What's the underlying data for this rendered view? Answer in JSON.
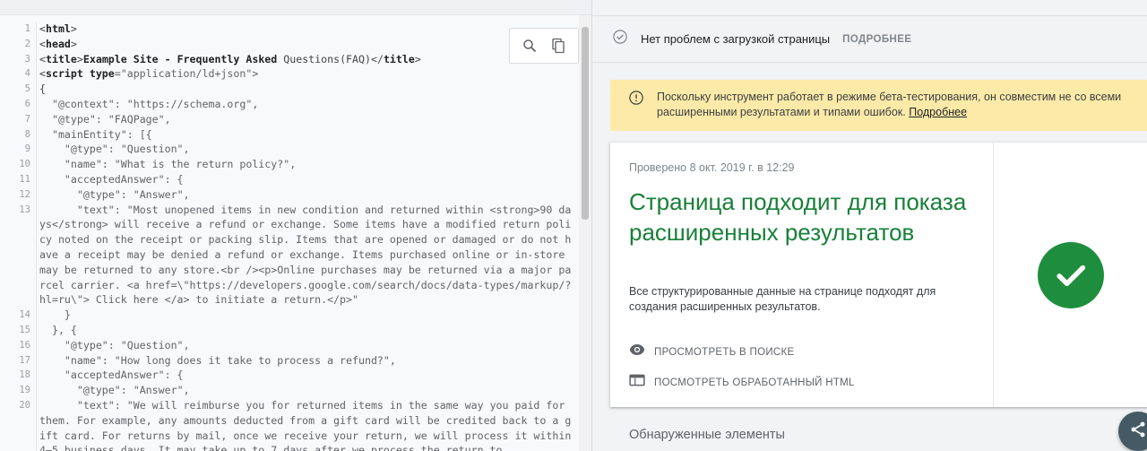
{
  "code": {
    "lines": [
      {
        "n": "1",
        "segments": [
          {
            "t": "<",
            "c": "p"
          },
          {
            "t": "html",
            "c": "tag"
          },
          {
            "t": ">",
            "c": "p"
          }
        ]
      },
      {
        "n": "2",
        "segments": [
          {
            "t": "<",
            "c": "p"
          },
          {
            "t": "head",
            "c": "tag"
          },
          {
            "t": ">",
            "c": "p"
          }
        ]
      },
      {
        "n": "3",
        "segments": [
          {
            "t": "<",
            "c": "p"
          },
          {
            "t": "title",
            "c": "tag"
          },
          {
            "t": ">",
            "c": "p"
          },
          {
            "t": "Example Site - Frequently Asked ",
            "c": "tag"
          },
          {
            "t": "Questions(FAQ)",
            "c": "p"
          },
          {
            "t": "</",
            "c": "p"
          },
          {
            "t": "title",
            "c": "tag"
          },
          {
            "t": ">",
            "c": "p"
          }
        ]
      },
      {
        "n": "4",
        "segments": [
          {
            "t": "<",
            "c": "p"
          },
          {
            "t": "script type",
            "c": "tag"
          },
          {
            "t": "=\"application/ld+json\">",
            "c": "str"
          }
        ]
      },
      {
        "n": "5",
        "segments": [
          {
            "t": "{",
            "c": "p"
          }
        ]
      },
      {
        "n": "6",
        "segments": [
          {
            "t": "  \"@context\": \"https://schema.org\",",
            "c": "str"
          }
        ]
      },
      {
        "n": "7",
        "segments": [
          {
            "t": "  \"@type\": \"FAQPage\",",
            "c": "str"
          }
        ]
      },
      {
        "n": "8",
        "segments": [
          {
            "t": "  \"mainEntity\": [{",
            "c": "str"
          }
        ]
      },
      {
        "n": "9",
        "segments": [
          {
            "t": "    \"@type\": \"Question\",",
            "c": "str"
          }
        ]
      },
      {
        "n": "10",
        "segments": [
          {
            "t": "    \"name\": \"What is the return policy?\",",
            "c": "str"
          }
        ]
      },
      {
        "n": "11",
        "segments": [
          {
            "t": "    \"acceptedAnswer\": {",
            "c": "str"
          }
        ]
      },
      {
        "n": "12",
        "segments": [
          {
            "t": "      \"@type\": \"Answer\",",
            "c": "str"
          }
        ]
      },
      {
        "n": "13",
        "segments": [
          {
            "t": "      \"text\": \"Most unopened items in new condition and returned within <strong>90 days</strong> will receive a refund or exchange. Some items have a modified return policy noted on the receipt or packing slip. Items that are opened or damaged or do not have a receipt may be denied a refund or exchange. Items purchased online or in-store may be returned to any store.<br /><p>Online purchases may be returned via a major parcel carrier. <a href=\\\"https://developers.google.com/search/docs/data-types/markup/?hl=ru\\\"> Click here </a> to initiate a return.</p>\"",
            "c": "str"
          }
        ]
      },
      {
        "n": "14",
        "segments": [
          {
            "t": "    }",
            "c": "str"
          }
        ]
      },
      {
        "n": "15",
        "segments": [
          {
            "t": "  }, {",
            "c": "str"
          }
        ]
      },
      {
        "n": "16",
        "segments": [
          {
            "t": "    \"@type\": \"Question\",",
            "c": "str"
          }
        ]
      },
      {
        "n": "17",
        "segments": [
          {
            "t": "    \"name\": \"How long does it take to process a refund?\",",
            "c": "str"
          }
        ]
      },
      {
        "n": "18",
        "segments": [
          {
            "t": "    \"acceptedAnswer\": {",
            "c": "str"
          }
        ]
      },
      {
        "n": "19",
        "segments": [
          {
            "t": "      \"@type\": \"Answer\",",
            "c": "str"
          }
        ]
      },
      {
        "n": "20",
        "segments": [
          {
            "t": "      \"text\": \"We will reimburse you for returned items in the same way you paid for them. For example, any amounts deducted from a gift card will be credited back to a gift card. For returns by mail, once we receive your return, we will process it within 4–5 business days. It may take up to 7 days after we process the return to",
            "c": "str"
          }
        ]
      }
    ],
    "tools": {
      "search_icon": "search-icon",
      "copy_icon": "copy-icon"
    }
  },
  "results": {
    "status_text": "Нет проблем с загрузкой страницы",
    "status_link": "ПОДРОБНЕЕ",
    "beta_text": "Поскольку инструмент работает в режиме бета-тестирования, он совместим не со всеми расширенными результатами и типами ошибок.",
    "beta_link": "Подробнее",
    "checked_at": "Проверено 8 окт. 2019 г. в 12:29",
    "title": "Страница подходит для показа расширенных результатов",
    "description": "Все структурированные данные на странице подходят для создания расширенных результатов.",
    "action_view_search": "ПРОСМОТРЕТЬ В ПОИСКЕ",
    "action_view_html": "ПОСМОТРЕТЬ ОБРАБОТАННЫЙ HTML",
    "detected_heading": "Обнаруженные элементы"
  },
  "colors": {
    "success_green": "#188038",
    "check_circle": "#1e8e3e",
    "banner_bg": "#fdeaa8",
    "fab_bg": "#455a64"
  }
}
